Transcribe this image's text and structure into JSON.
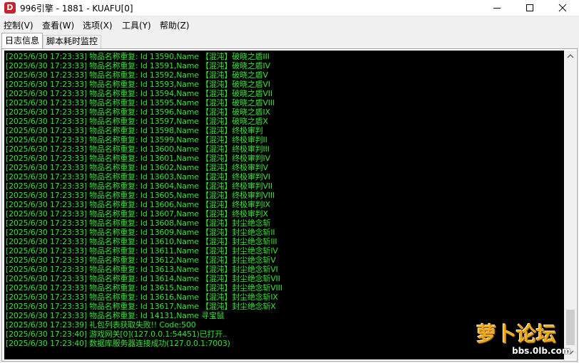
{
  "window": {
    "title": "996引擎 - 1881 - KUAFU[0]",
    "app_icon_letter": "D",
    "controls": [
      "minimize-icon",
      "maximize-icon",
      "close-icon"
    ]
  },
  "menu": {
    "items": [
      {
        "label": "控制(V)"
      },
      {
        "label": "查看(W)"
      },
      {
        "label": "选项(X)"
      },
      {
        "label": "工具(Y)"
      },
      {
        "label": "帮助(Z)"
      }
    ]
  },
  "tabs": [
    {
      "label": "日志信息",
      "active": true
    },
    {
      "label": "脚本耗时监控",
      "active": false
    }
  ],
  "log": {
    "text_color": "#2fe52f",
    "background": "#000000",
    "lines": [
      "[2025/6/30 17:23:33] 物品名称重复: Id 13590,Name 【混沌】破晓之盾III",
      "[2025/6/30 17:23:33] 物品名称重复: Id 13591,Name 【混沌】破晓之盾IV",
      "[2025/6/30 17:23:33] 物品名称重复: Id 13592,Name 【混沌】破晓之盾V",
      "[2025/6/30 17:23:33] 物品名称重复: Id 13593,Name 【混沌】破晓之盾VI",
      "[2025/6/30 17:23:33] 物品名称重复: Id 13594,Name 【混沌】破晓之盾VII",
      "[2025/6/30 17:23:33] 物品名称重复: Id 13595,Name 【混沌】破晓之盾VIII",
      "[2025/6/30 17:23:33] 物品名称重复: Id 13596,Name 【混沌】破晓之盾IX",
      "[2025/6/30 17:23:33] 物品名称重复: Id 13597,Name 【混沌】破晓之盾X",
      "[2025/6/30 17:23:33] 物品名称重复: Id 13598,Name 【混沌】终极审判",
      "[2025/6/30 17:23:33] 物品名称重复: Id 13599,Name 【混沌】终极审判II",
      "[2025/6/30 17:23:33] 物品名称重复: Id 13600,Name 【混沌】终极审判III",
      "[2025/6/30 17:23:33] 物品名称重复: Id 13601,Name 【混沌】终极审判IV",
      "[2025/6/30 17:23:33] 物品名称重复: Id 13602,Name 【混沌】终极审判V",
      "[2025/6/30 17:23:33] 物品名称重复: Id 13603,Name 【混沌】终极审判VI",
      "[2025/6/30 17:23:33] 物品名称重复: Id 13604,Name 【混沌】终极审判VII",
      "[2025/6/30 17:23:33] 物品名称重复: Id 13605,Name 【混沌】终极审判VIII",
      "[2025/6/30 17:23:33] 物品名称重复: Id 13606,Name 【混沌】终极审判IX",
      "[2025/6/30 17:23:33] 物品名称重复: Id 13607,Name 【混沌】终极审判X",
      "[2025/6/30 17:23:33] 物品名称重复: Id 13608,Name 【混沌】封尘绝念斩",
      "[2025/6/30 17:23:33] 物品名称重复: Id 13609,Name 【混沌】封尘绝念斩II",
      "[2025/6/30 17:23:33] 物品名称重复: Id 13610,Name 【混沌】封尘绝念斩III",
      "[2025/6/30 17:23:33] 物品名称重复: Id 13611,Name 【混沌】封尘绝念斩IV",
      "[2025/6/30 17:23:33] 物品名称重复: Id 13612,Name 【混沌】封尘绝念斩V",
      "[2025/6/30 17:23:33] 物品名称重复: Id 13613,Name 【混沌】封尘绝念斩VI",
      "[2025/6/30 17:23:33] 物品名称重复: Id 13614,Name 【混沌】封尘绝念斩VII",
      "[2025/6/30 17:23:33] 物品名称重复: Id 13615,Name 【混沌】封尘绝念斩VIII",
      "[2025/6/30 17:23:33] 物品名称重复: Id 13616,Name 【混沌】封尘绝念斩IX",
      "[2025/6/30 17:23:33] 物品名称重复: Id 13617,Name 【混沌】封尘绝念斩X",
      "[2025/6/30 17:23:33] 物品名称重复: Id 14131,Name 寻宝鼠",
      "[2025/6/30 17:23:39] 礼包列表获取失败!! Code:500",
      "[2025/6/30 17:23:40] 游戏网关[0](127.0.0.1:54451)已打开..",
      "[2025/6/30 17:23:40] 数据库服务器连接成功(127.0.0.1:7003)"
    ]
  },
  "watermark": {
    "title": "萝卜论坛",
    "url": "bbs.0lb.com"
  }
}
